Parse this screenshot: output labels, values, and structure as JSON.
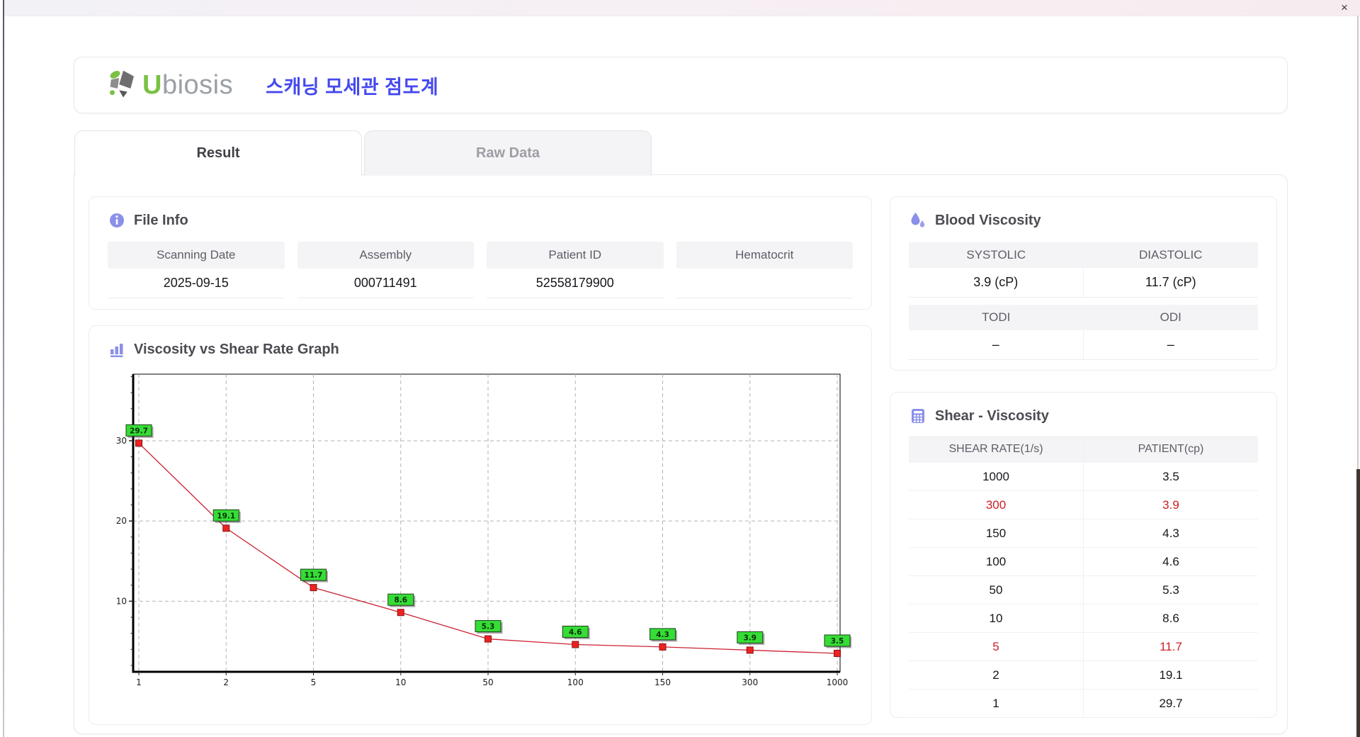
{
  "window": {
    "close_label": "×"
  },
  "header": {
    "logo_first_letter": "U",
    "logo_rest": "biosis",
    "title_korean": "스캐닝 모세관 점도계"
  },
  "tabs": [
    {
      "label": "Result",
      "active": true
    },
    {
      "label": "Raw Data",
      "active": false
    }
  ],
  "file_info": {
    "title": "File Info",
    "fields": [
      {
        "label": "Scanning Date",
        "value": "2025-09-15"
      },
      {
        "label": "Assembly",
        "value": "000711491"
      },
      {
        "label": "Patient ID",
        "value": "52558179900"
      },
      {
        "label": "Hematocrit",
        "value": ""
      }
    ]
  },
  "blood_viscosity": {
    "title": "Blood Viscosity",
    "rows": [
      {
        "cells": [
          {
            "label": "SYSTOLIC",
            "value": "3.9 (cP)"
          },
          {
            "label": "DIASTOLIC",
            "value": "11.7 (cP)"
          }
        ]
      },
      {
        "cells": [
          {
            "label": "TODI",
            "value": "–"
          },
          {
            "label": "ODI",
            "value": "–"
          }
        ]
      }
    ]
  },
  "graph": {
    "title": "Viscosity vs Shear Rate Graph"
  },
  "chart_data": {
    "type": "line",
    "title": "Viscosity vs Shear Rate Graph",
    "xlabel": "",
    "ylabel": "",
    "x_axis_type": "categorical",
    "categories": [
      "1",
      "2",
      "5",
      "10",
      "50",
      "100",
      "150",
      "300",
      "1000"
    ],
    "values": [
      29.7,
      19.1,
      11.7,
      8.6,
      5.3,
      4.6,
      4.3,
      3.9,
      3.5
    ],
    "data_labels": [
      "29.7",
      "19.1",
      "11.7",
      "8.6",
      "5.3",
      "4.6",
      "4.3",
      "3.9",
      "3.5"
    ],
    "y_ticks": [
      10,
      20,
      30
    ],
    "ylim": [
      1.2,
      38.3
    ],
    "grid": "dashed",
    "line_color": "#cc2233",
    "marker_color": "#ee2222",
    "marker_stroke": "#881111",
    "label_box_color": "#35dd35",
    "label_box_stroke": "#1c401c",
    "grid_color": "#b3b3b3",
    "axis_color": "#000000"
  },
  "shear_table": {
    "title": "Shear - Viscosity",
    "columns": [
      "SHEAR RATE(1/s)",
      "PATIENT(cp)"
    ],
    "rows": [
      {
        "shear": "1000",
        "patient": "3.5",
        "highlight": false
      },
      {
        "shear": "300",
        "patient": "3.9",
        "highlight": true
      },
      {
        "shear": "150",
        "patient": "4.3",
        "highlight": false
      },
      {
        "shear": "100",
        "patient": "4.6",
        "highlight": false
      },
      {
        "shear": "50",
        "patient": "5.3",
        "highlight": false
      },
      {
        "shear": "10",
        "patient": "8.6",
        "highlight": false
      },
      {
        "shear": "5",
        "patient": "11.7",
        "highlight": true
      },
      {
        "shear": "2",
        "patient": "19.1",
        "highlight": false
      },
      {
        "shear": "1",
        "patient": "29.7",
        "highlight": false
      }
    ]
  },
  "colors": {
    "accent_purple": "#8a90e8",
    "title_blue": "#4549ef",
    "logo_green": "#7ac143",
    "logo_gray": "#9aa0a6",
    "highlight_red": "#cb2127"
  }
}
